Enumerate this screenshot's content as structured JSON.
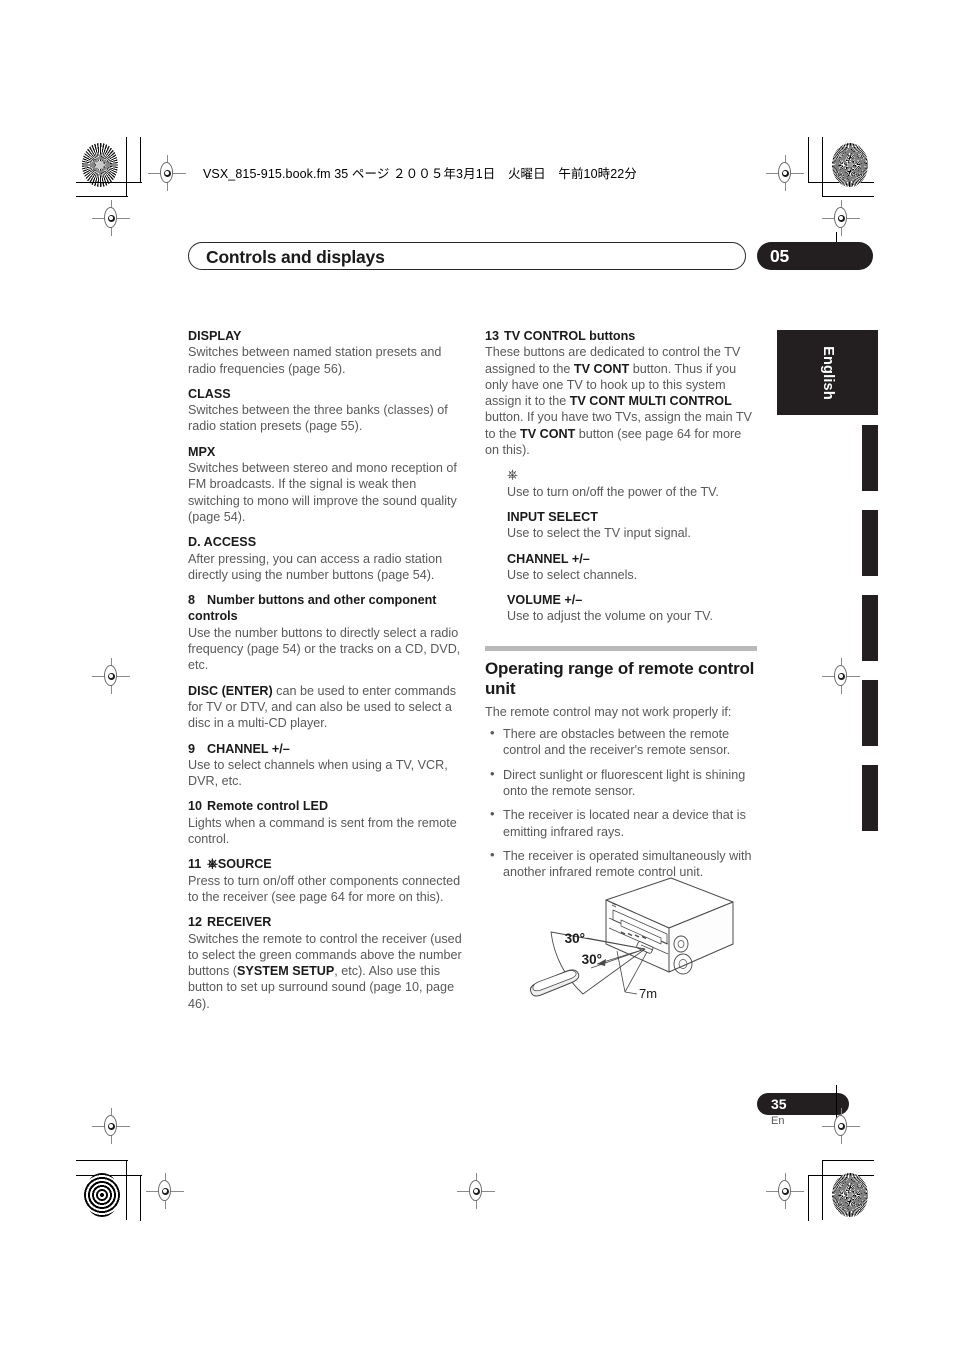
{
  "print": {
    "filename_line": "VSX_815-915.book.fm  35 ページ  ２００５年3月1日　火曜日　午前10時22分"
  },
  "header": {
    "title": "Controls and displays",
    "chapter": "05"
  },
  "side": {
    "language_tab": "English"
  },
  "left_column": [
    {
      "id": "display",
      "heading": "DISPLAY",
      "body": "Switches between named station presets and radio frequencies (page 56)."
    },
    {
      "id": "class",
      "heading": "CLASS",
      "body": "Switches between the three banks (classes) of radio station presets (page 55)."
    },
    {
      "id": "mpx",
      "heading": "MPX",
      "body": "Switches between stereo and mono reception of FM broadcasts. If the signal is weak then switching to mono will improve the sound quality (page 54)."
    },
    {
      "id": "d-access",
      "heading": "D. ACCESS",
      "body": "After pressing, you can access a radio station directly using the number buttons (page 54)."
    },
    {
      "id": "number-buttons",
      "number": "8",
      "heading": "Number buttons and other component controls",
      "body": "Use the number buttons to directly select a radio frequency (page 54) or the tracks on a CD, DVD, etc.",
      "body2_bold": "DISC (ENTER)",
      "body2_rest": " can be used to enter commands for TV or DTV, and can also be used to select a disc in a multi-CD player."
    },
    {
      "id": "channel",
      "number": "9",
      "heading": "CHANNEL +/–",
      "body": "Use to select channels when using a TV, VCR, DVR, etc."
    },
    {
      "id": "remote-control-led",
      "number": "10",
      "heading": "Remote control LED",
      "body": "Lights when a command is sent from the remote control."
    },
    {
      "id": "source",
      "number": "11",
      "heading_icon": "power-icon",
      "heading": "SOURCE",
      "body": "Press to turn on/off other components connected to the receiver (see page 64 for more on this)."
    },
    {
      "id": "receiver",
      "number": "12",
      "heading": "RECEIVER",
      "body_a": "Switches the remote to control the receiver (used to select the green commands above the number buttons (",
      "body_bold": "SYSTEM SETUP",
      "body_b": ", etc). Also use this button to set up surround sound (page 10, page 46)."
    }
  ],
  "right_column": {
    "tv_control": {
      "number": "13",
      "heading_bold": "TV CONTROL",
      "heading_rest": " buttons",
      "para_1a": "These buttons are dedicated to control the TV assigned to the ",
      "para_1b": "TV CONT",
      "para_1c": " button. Thus if you only have one TV to hook up to this system assign it to the ",
      "para_1d": "TV CONT MULTI CONTROL",
      "para_1e": " button. If you have two TVs, assign the main TV to the ",
      "para_1f": "TV CONT",
      "para_1g": " button (see page 64 for more on this)."
    },
    "sub_items": [
      {
        "id": "tv-power",
        "icon": "power-icon",
        "heading": "",
        "body": "Use to turn on/off the power of the TV."
      },
      {
        "id": "input-select",
        "heading": "INPUT SELECT",
        "body": "Use to select the TV input signal."
      },
      {
        "id": "tv-channel",
        "heading": "CHANNEL +/–",
        "body": "Use to select channels."
      },
      {
        "id": "tv-volume",
        "heading": "VOLUME +/–",
        "body": "Use to adjust the volume on your TV."
      }
    ],
    "operating_range": {
      "heading": "Operating range of remote control unit",
      "intro": "The remote control may not work properly if:",
      "bullets": [
        "There are obstacles between the remote control and the receiver's remote sensor.",
        "Direct sunlight or fluorescent light is shining onto the remote sensor.",
        "The receiver is located near a device that is emitting infrared rays.",
        "The receiver is operated simultaneously with another infrared remote control unit."
      ]
    }
  },
  "illustration": {
    "angle_upper": "30°",
    "angle_lower": "30°",
    "distance": "7m"
  },
  "footer": {
    "page_number": "35",
    "page_suffix": "En"
  }
}
